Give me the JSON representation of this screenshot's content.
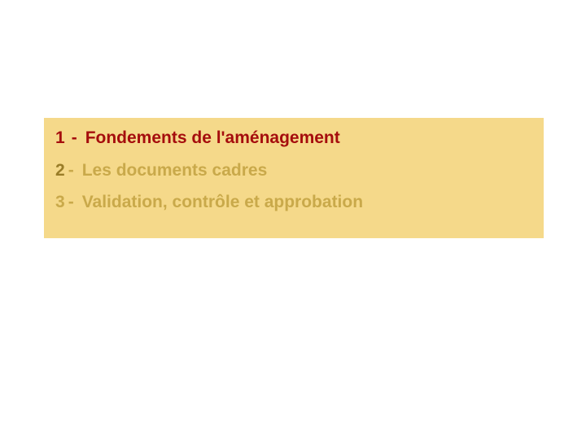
{
  "items": [
    {
      "num": "1",
      "sep": "-",
      "label": "Fondements de l'aménagement"
    },
    {
      "num": "2",
      "sep": "-",
      "label": "Les documents cadres"
    },
    {
      "num": "3",
      "sep": "-",
      "label": "Validation, contrôle et approbation"
    }
  ]
}
